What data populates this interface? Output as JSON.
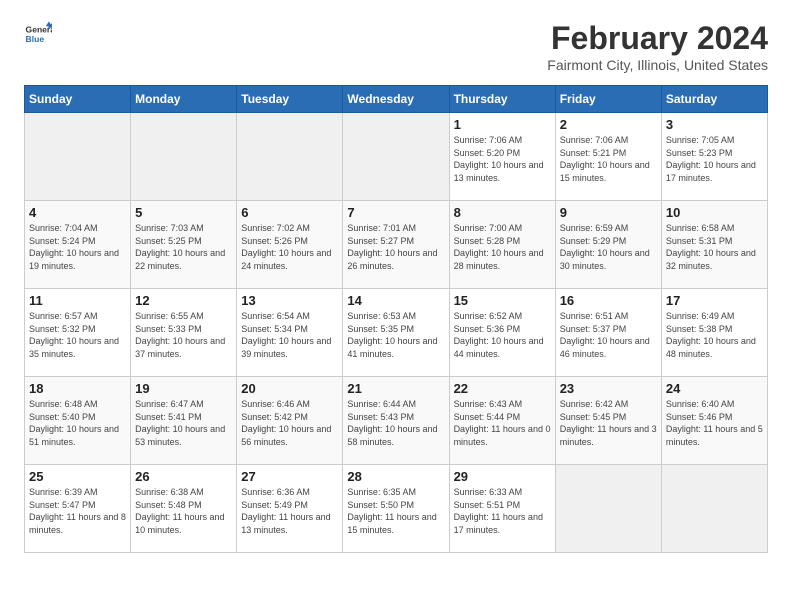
{
  "app": {
    "name_general": "General",
    "name_blue": "Blue"
  },
  "calendar": {
    "title": "February 2024",
    "subtitle": "Fairmont City, Illinois, United States",
    "days_of_week": [
      "Sunday",
      "Monday",
      "Tuesday",
      "Wednesday",
      "Thursday",
      "Friday",
      "Saturday"
    ],
    "weeks": [
      [
        {
          "day": "",
          "sunrise": "",
          "sunset": "",
          "daylight": "",
          "empty": true
        },
        {
          "day": "",
          "sunrise": "",
          "sunset": "",
          "daylight": "",
          "empty": true
        },
        {
          "day": "",
          "sunrise": "",
          "sunset": "",
          "daylight": "",
          "empty": true
        },
        {
          "day": "",
          "sunrise": "",
          "sunset": "",
          "daylight": "",
          "empty": true
        },
        {
          "day": "1",
          "sunrise": "7:06 AM",
          "sunset": "5:20 PM",
          "daylight": "10 hours and 13 minutes."
        },
        {
          "day": "2",
          "sunrise": "7:06 AM",
          "sunset": "5:21 PM",
          "daylight": "10 hours and 15 minutes."
        },
        {
          "day": "3",
          "sunrise": "7:05 AM",
          "sunset": "5:23 PM",
          "daylight": "10 hours and 17 minutes."
        }
      ],
      [
        {
          "day": "4",
          "sunrise": "7:04 AM",
          "sunset": "5:24 PM",
          "daylight": "10 hours and 19 minutes."
        },
        {
          "day": "5",
          "sunrise": "7:03 AM",
          "sunset": "5:25 PM",
          "daylight": "10 hours and 22 minutes."
        },
        {
          "day": "6",
          "sunrise": "7:02 AM",
          "sunset": "5:26 PM",
          "daylight": "10 hours and 24 minutes."
        },
        {
          "day": "7",
          "sunrise": "7:01 AM",
          "sunset": "5:27 PM",
          "daylight": "10 hours and 26 minutes."
        },
        {
          "day": "8",
          "sunrise": "7:00 AM",
          "sunset": "5:28 PM",
          "daylight": "10 hours and 28 minutes."
        },
        {
          "day": "9",
          "sunrise": "6:59 AM",
          "sunset": "5:29 PM",
          "daylight": "10 hours and 30 minutes."
        },
        {
          "day": "10",
          "sunrise": "6:58 AM",
          "sunset": "5:31 PM",
          "daylight": "10 hours and 32 minutes."
        }
      ],
      [
        {
          "day": "11",
          "sunrise": "6:57 AM",
          "sunset": "5:32 PM",
          "daylight": "10 hours and 35 minutes."
        },
        {
          "day": "12",
          "sunrise": "6:55 AM",
          "sunset": "5:33 PM",
          "daylight": "10 hours and 37 minutes."
        },
        {
          "day": "13",
          "sunrise": "6:54 AM",
          "sunset": "5:34 PM",
          "daylight": "10 hours and 39 minutes."
        },
        {
          "day": "14",
          "sunrise": "6:53 AM",
          "sunset": "5:35 PM",
          "daylight": "10 hours and 41 minutes."
        },
        {
          "day": "15",
          "sunrise": "6:52 AM",
          "sunset": "5:36 PM",
          "daylight": "10 hours and 44 minutes."
        },
        {
          "day": "16",
          "sunrise": "6:51 AM",
          "sunset": "5:37 PM",
          "daylight": "10 hours and 46 minutes."
        },
        {
          "day": "17",
          "sunrise": "6:49 AM",
          "sunset": "5:38 PM",
          "daylight": "10 hours and 48 minutes."
        }
      ],
      [
        {
          "day": "18",
          "sunrise": "6:48 AM",
          "sunset": "5:40 PM",
          "daylight": "10 hours and 51 minutes."
        },
        {
          "day": "19",
          "sunrise": "6:47 AM",
          "sunset": "5:41 PM",
          "daylight": "10 hours and 53 minutes."
        },
        {
          "day": "20",
          "sunrise": "6:46 AM",
          "sunset": "5:42 PM",
          "daylight": "10 hours and 56 minutes."
        },
        {
          "day": "21",
          "sunrise": "6:44 AM",
          "sunset": "5:43 PM",
          "daylight": "10 hours and 58 minutes."
        },
        {
          "day": "22",
          "sunrise": "6:43 AM",
          "sunset": "5:44 PM",
          "daylight": "11 hours and 0 minutes."
        },
        {
          "day": "23",
          "sunrise": "6:42 AM",
          "sunset": "5:45 PM",
          "daylight": "11 hours and 3 minutes."
        },
        {
          "day": "24",
          "sunrise": "6:40 AM",
          "sunset": "5:46 PM",
          "daylight": "11 hours and 5 minutes."
        }
      ],
      [
        {
          "day": "25",
          "sunrise": "6:39 AM",
          "sunset": "5:47 PM",
          "daylight": "11 hours and 8 minutes."
        },
        {
          "day": "26",
          "sunrise": "6:38 AM",
          "sunset": "5:48 PM",
          "daylight": "11 hours and 10 minutes."
        },
        {
          "day": "27",
          "sunrise": "6:36 AM",
          "sunset": "5:49 PM",
          "daylight": "11 hours and 13 minutes."
        },
        {
          "day": "28",
          "sunrise": "6:35 AM",
          "sunset": "5:50 PM",
          "daylight": "11 hours and 15 minutes."
        },
        {
          "day": "29",
          "sunrise": "6:33 AM",
          "sunset": "5:51 PM",
          "daylight": "11 hours and 17 minutes."
        },
        {
          "day": "",
          "sunrise": "",
          "sunset": "",
          "daylight": "",
          "empty": true
        },
        {
          "day": "",
          "sunrise": "",
          "sunset": "",
          "daylight": "",
          "empty": true
        }
      ]
    ]
  }
}
